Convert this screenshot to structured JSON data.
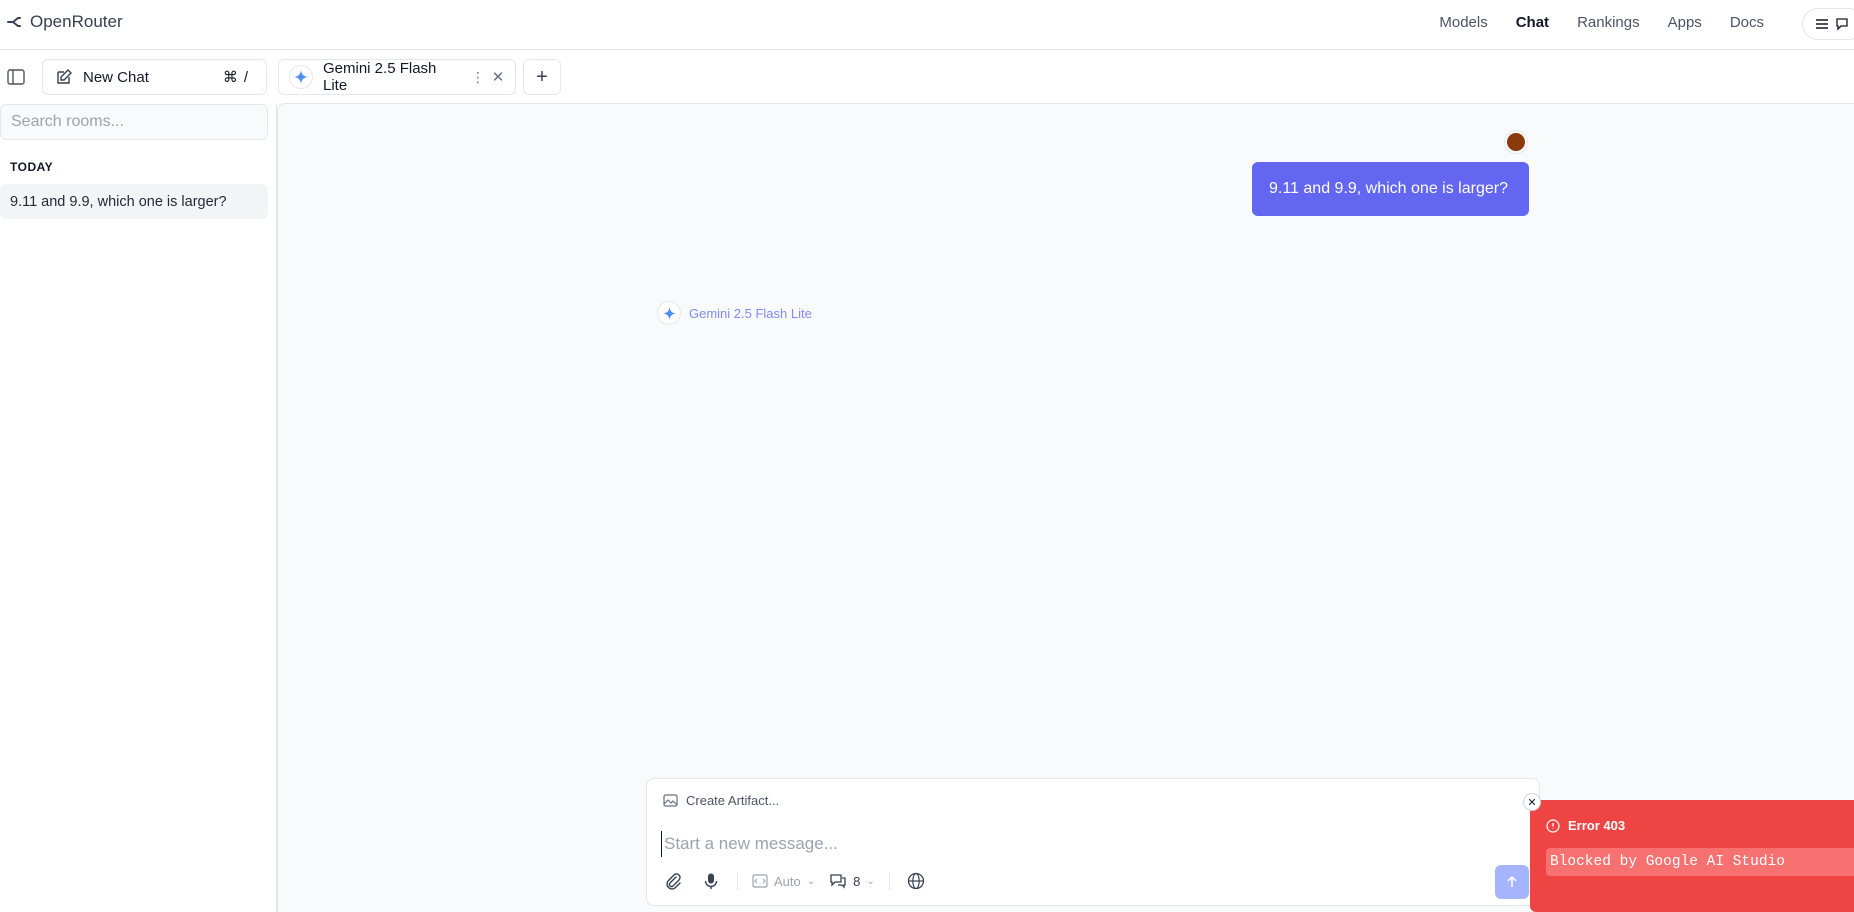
{
  "nav": {
    "brand": "OpenRouter",
    "links": [
      "Models",
      "Chat",
      "Rankings",
      "Apps",
      "Docs"
    ],
    "active": "Chat"
  },
  "tabbar": {
    "new_chat_label": "New Chat",
    "new_chat_shortcut": "⌘/",
    "model_tab_label": "Gemini 2.5 Flash Lite",
    "add_tab": "+"
  },
  "sidebar": {
    "search_placeholder": "Search rooms...",
    "section_label": "TODAY",
    "rooms": [
      "9.11 and 9.9, which one is larger?"
    ]
  },
  "chat": {
    "user_message": "9.11 and 9.9, which one is larger?",
    "assistant_model": "Gemini 2.5 Flash Lite"
  },
  "composer": {
    "artifact_label": "Create Artifact...",
    "placeholder": "Start a new message...",
    "mode_label": "Auto",
    "context_count": "8"
  },
  "toast": {
    "title": "Error 403",
    "message": "Blocked by Google AI Studio"
  },
  "colors": {
    "accent": "#6366f1",
    "error": "#ef4444",
    "avatar": "#8b3a0e"
  }
}
